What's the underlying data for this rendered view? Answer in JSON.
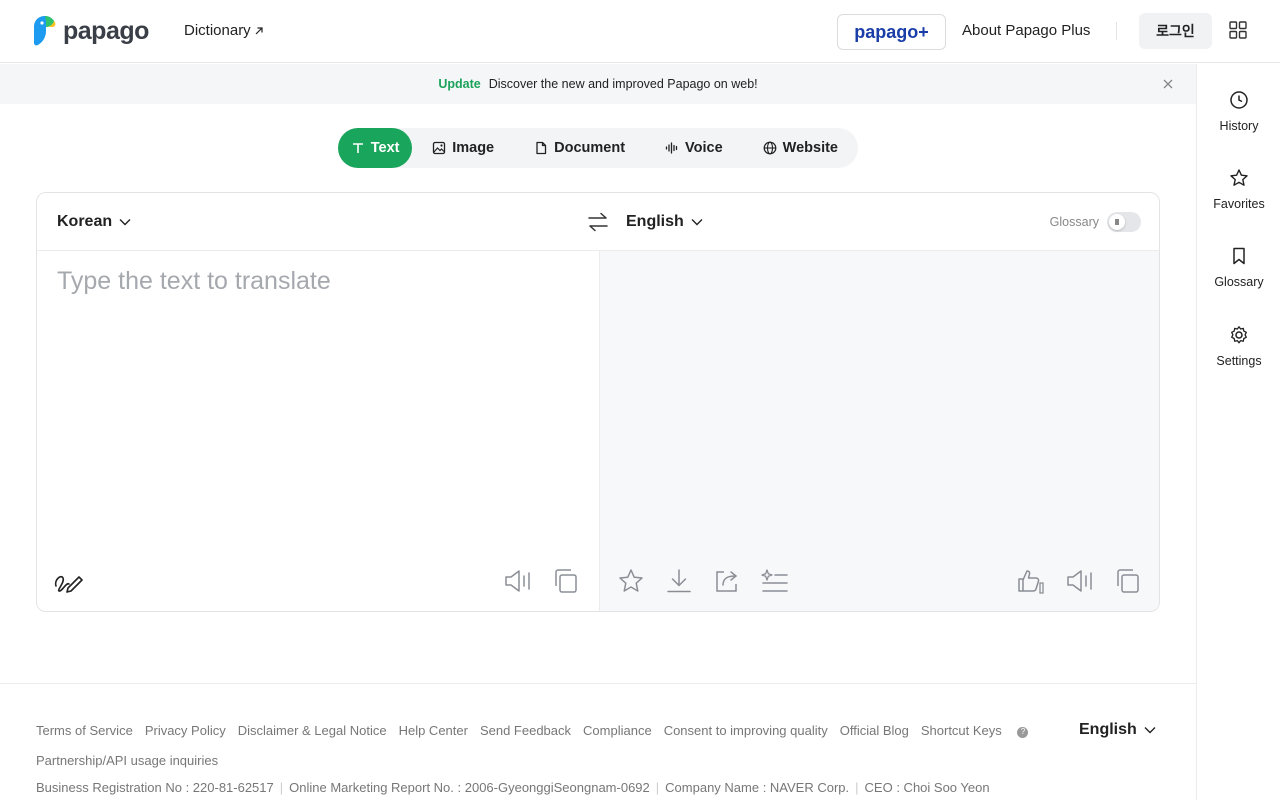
{
  "header": {
    "logo_text": "papago",
    "dictionary_label": "Dictionary",
    "plus_badge": "papago+",
    "about_plus": "About Papago Plus",
    "login_label": "로그인"
  },
  "banner": {
    "tag": "Update",
    "message": "Discover the new and improved Papago on web!"
  },
  "sidebar": {
    "items": [
      {
        "label": "History",
        "icon": "clock-icon"
      },
      {
        "label": "Favorites",
        "icon": "star-icon"
      },
      {
        "label": "Glossary",
        "icon": "bookmark-icon"
      },
      {
        "label": "Settings",
        "icon": "gear-icon"
      }
    ]
  },
  "tabs": [
    {
      "label": "Text",
      "icon": "text-icon",
      "active": true
    },
    {
      "label": "Image",
      "icon": "image-icon"
    },
    {
      "label": "Document",
      "icon": "document-icon"
    },
    {
      "label": "Voice",
      "icon": "voice-icon"
    },
    {
      "label": "Website",
      "icon": "globe-icon"
    }
  ],
  "translator": {
    "source_lang": "Korean",
    "target_lang": "English",
    "glossary_label": "Glossary",
    "source_placeholder": "Type the text to translate",
    "source_value": ""
  },
  "footer": {
    "links": [
      "Terms of Service",
      "Privacy Policy",
      "Disclaimer & Legal Notice",
      "Help Center",
      "Send Feedback",
      "Compliance",
      "Consent to improving quality",
      "Official Blog",
      "Shortcut Keys",
      "Partnership/API usage inquiries"
    ],
    "info": [
      "Business Registration No : 220-81-62517",
      "Online Marketing Report No. : 2006-GyeonggiSeongnam-0692",
      "Company Name : NAVER Corp.",
      "CEO : Choi Soo Yeon"
    ],
    "language": "English"
  },
  "colors": {
    "accent": "#19a55b",
    "plus_blue": "#1a3ea8"
  }
}
